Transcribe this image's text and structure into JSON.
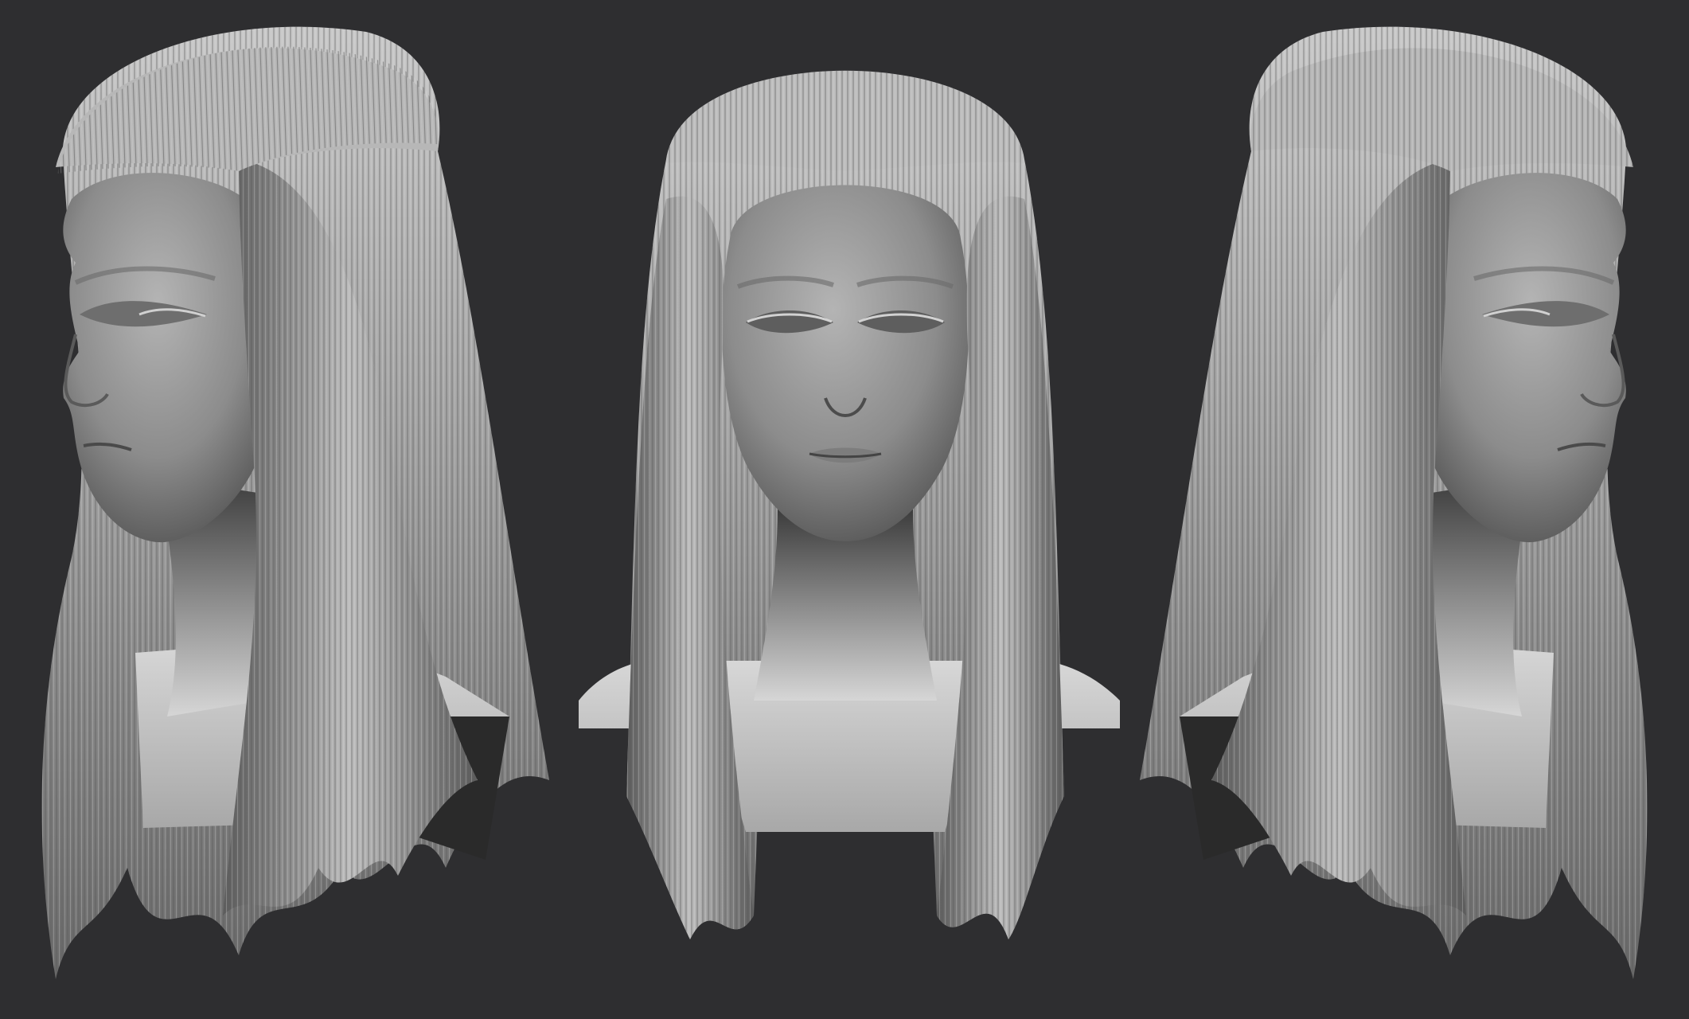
{
  "scene": {
    "background_color": "#2e2e30",
    "clay_light": "#cfcfcf",
    "clay_mid": "#8d8d8d",
    "clay_dark": "#3a3a3a",
    "views": [
      {
        "id": "left",
        "description_icon": "head-three-quarter-left"
      },
      {
        "id": "front",
        "description_icon": "head-front"
      },
      {
        "id": "right",
        "description_icon": "head-three-quarter-right"
      }
    ]
  }
}
